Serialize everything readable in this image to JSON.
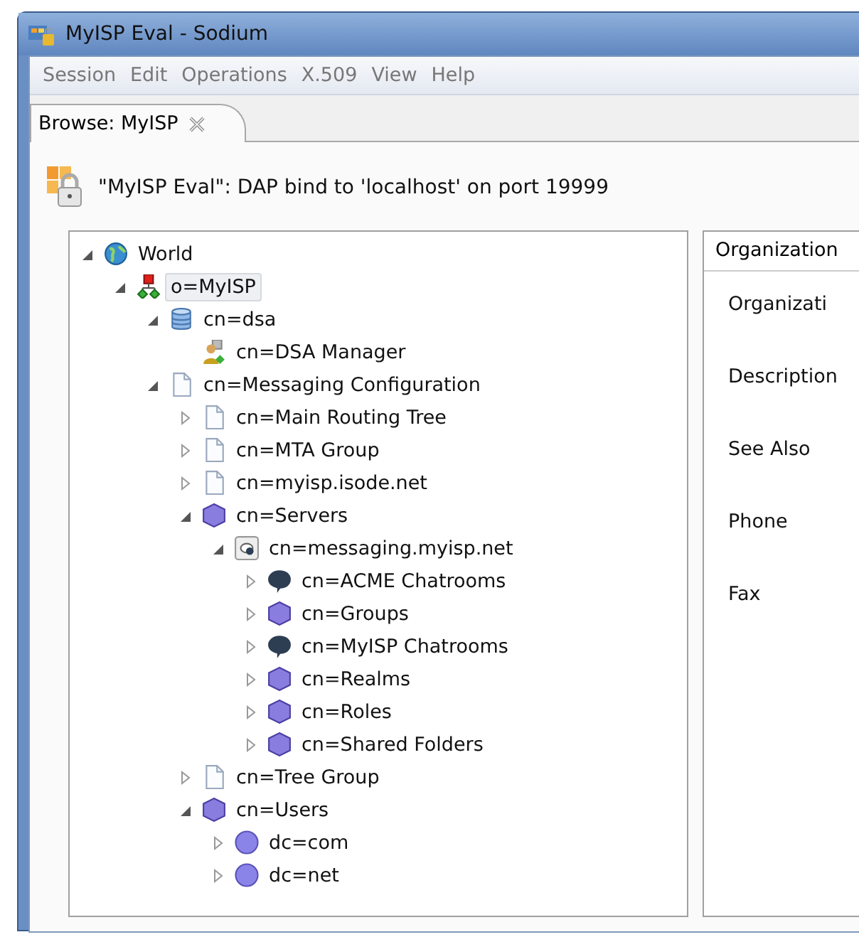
{
  "window": {
    "title": "MyISP Eval - Sodium"
  },
  "menu": [
    "Session",
    "Edit",
    "Operations",
    "X.509",
    "View",
    "Help"
  ],
  "tabs": [
    {
      "label": "Browse: MyISP",
      "selected": true
    }
  ],
  "bind_message": "\"MyISP Eval\": DAP bind to 'localhost' on port 19999",
  "tree": [
    {
      "label": "World",
      "kind": "globe",
      "expanded": true,
      "selected": false,
      "children": [
        {
          "label": "o=MyISP",
          "kind": "org",
          "expanded": true,
          "selected": true,
          "children": [
            {
              "label": "cn=dsa",
              "kind": "database",
              "expanded": true,
              "selected": false,
              "children": [
                {
                  "label": "cn=DSA Manager",
                  "kind": "person",
                  "selected": false
                }
              ]
            },
            {
              "label": "cn=Messaging Configuration",
              "kind": "document",
              "expanded": true,
              "selected": false,
              "children": [
                {
                  "label": "cn=Main Routing Tree",
                  "kind": "document",
                  "expanded": false,
                  "selected": false
                },
                {
                  "label": "cn=MTA Group",
                  "kind": "document",
                  "expanded": false,
                  "selected": false
                },
                {
                  "label": "cn=myisp.isode.net",
                  "kind": "document",
                  "expanded": false,
                  "selected": false
                },
                {
                  "label": "cn=Servers",
                  "kind": "cube",
                  "expanded": true,
                  "selected": false,
                  "children": [
                    {
                      "label": "cn=messaging.myisp.net",
                      "kind": "server",
                      "expanded": true,
                      "selected": false,
                      "children": [
                        {
                          "label": "cn=ACME Chatrooms",
                          "kind": "chat",
                          "expanded": false,
                          "selected": false
                        },
                        {
                          "label": "cn=Groups",
                          "kind": "cube",
                          "expanded": false,
                          "selected": false
                        },
                        {
                          "label": "cn=MyISP Chatrooms",
                          "kind": "chat",
                          "expanded": false,
                          "selected": false
                        },
                        {
                          "label": "cn=Realms",
                          "kind": "cube",
                          "expanded": false,
                          "selected": false
                        },
                        {
                          "label": "cn=Roles",
                          "kind": "cube",
                          "expanded": false,
                          "selected": false
                        },
                        {
                          "label": "cn=Shared Folders",
                          "kind": "cube",
                          "expanded": false,
                          "selected": false
                        }
                      ]
                    }
                  ]
                },
                {
                  "label": "cn=Tree Group",
                  "kind": "document",
                  "expanded": false,
                  "selected": false
                },
                {
                  "label": "cn=Users",
                  "kind": "cube",
                  "expanded": true,
                  "selected": false,
                  "children": [
                    {
                      "label": "dc=com",
                      "kind": "sphere",
                      "expanded": false,
                      "selected": false
                    },
                    {
                      "label": "dc=net",
                      "kind": "sphere",
                      "expanded": false,
                      "selected": false
                    }
                  ]
                }
              ]
            }
          ]
        }
      ]
    }
  ],
  "details": {
    "tab": "Organization",
    "fields": [
      "Organizati",
      "Description",
      "See Also",
      "Phone",
      "Fax"
    ]
  }
}
